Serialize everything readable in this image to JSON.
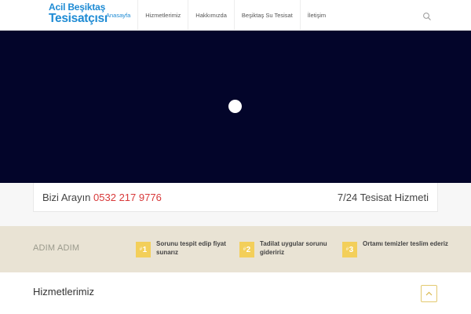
{
  "logo": {
    "line1": "Acil Beşiktaş",
    "line2": "Tesisatçısı"
  },
  "nav": {
    "items": [
      {
        "label": "Anasayfa"
      },
      {
        "label": "Hizmetlerimiz"
      },
      {
        "label": "Hakkımızda"
      },
      {
        "label": "Beşiktaş Su Tesisat"
      },
      {
        "label": "İletişim"
      }
    ],
    "active_index": 0,
    "search_icon": "search-icon"
  },
  "callbar": {
    "prefix": "Bizi Arayın",
    "phone": "0532 217 9776",
    "service": "7/24 Tesisat Hizmeti"
  },
  "steps": {
    "title": "ADIM ADIM",
    "items": [
      {
        "hash": "#",
        "number": "1",
        "text": "Sorunu tespit edip fiyat sunarız"
      },
      {
        "hash": "#",
        "number": "2",
        "text": "Tadilat uygular sorunu gideririz"
      },
      {
        "hash": "#",
        "number": "3",
        "text": "Ortamı temizler teslim ederiz"
      }
    ]
  },
  "services": {
    "title": "Hizmetlerimiz"
  },
  "colors": {
    "brand": "#1e8bd4",
    "phone": "#d8393a",
    "hero_bg": "#03052a",
    "steps_bg": "#e9e3d4",
    "badge": "#f3cf5a"
  },
  "icons": {
    "search": "search-icon",
    "scroll_top": "chevron-up-icon",
    "loader": "loading-dot-icon"
  }
}
